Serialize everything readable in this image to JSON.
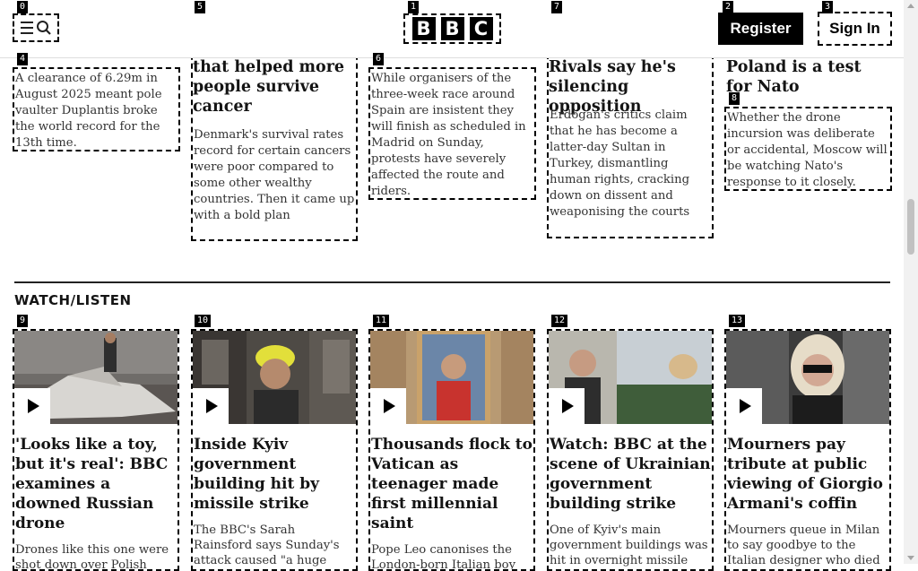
{
  "header": {
    "logo_letters": [
      "B",
      "B",
      "C"
    ],
    "register_label": "Register",
    "signin_label": "Sign In"
  },
  "badges": [
    "0",
    "1",
    "2",
    "3",
    "4",
    "5",
    "6",
    "7",
    "8",
    "9",
    "10",
    "11",
    "12",
    "13"
  ],
  "top_stories": [
    {
      "headline": "",
      "summary": "A clearance of 6.29m in August 2025 meant pole vaulter Duplantis broke the world record for the 13th time."
    },
    {
      "headline": "that helped more people survive cancer",
      "summary": "Denmark's survival rates record for certain cancers were poor compared to some other wealthy countries. Then it came up with a bold plan"
    },
    {
      "headline": "",
      "summary": "While organisers of the three-week race around Spain are insistent they will finish as scheduled in Madrid on Sunday, protests have severely affected the route and riders."
    },
    {
      "headline": "Rivals say he's silencing opposition",
      "summary": "Erdogan's critics claim that he has become a latter-day Sultan in Turkey, dismantling human rights, cracking down on dissent and weaponising the courts"
    },
    {
      "headline": "Poland is a test for Nato",
      "summary": "Whether the drone incursion was deliberate or accidental, Moscow will be watching Nato's response to it closely."
    }
  ],
  "watch_listen": {
    "title": "WATCH/LISTEN",
    "cards": [
      {
        "headline": "'Looks like a toy, but it's real': BBC examines a downed Russian drone",
        "summary": "Drones like this one were shot down over Polish airspace in the early hours"
      },
      {
        "headline": "Inside Kyiv government building hit by missile strike",
        "summary": "The BBC's Sarah Rainsford says Sunday's attack caused \"a huge amount of damage\"."
      },
      {
        "headline": "Thousands flock to Vatican as teenager made first millennial saint",
        "summary": "Pope Leo canonises the London-born Italian boy nicknamed \"God's"
      },
      {
        "headline": "Watch: BBC at the scene of Ukrainian government building strike",
        "summary": "One of Kyiv's main government buildings was hit in overnight missile"
      },
      {
        "headline": "Mourners pay tribute at public viewing of Giorgio Armani's coffin",
        "summary": "Mourners queue in Milan to say goodbye to the Italian designer who died"
      }
    ]
  }
}
